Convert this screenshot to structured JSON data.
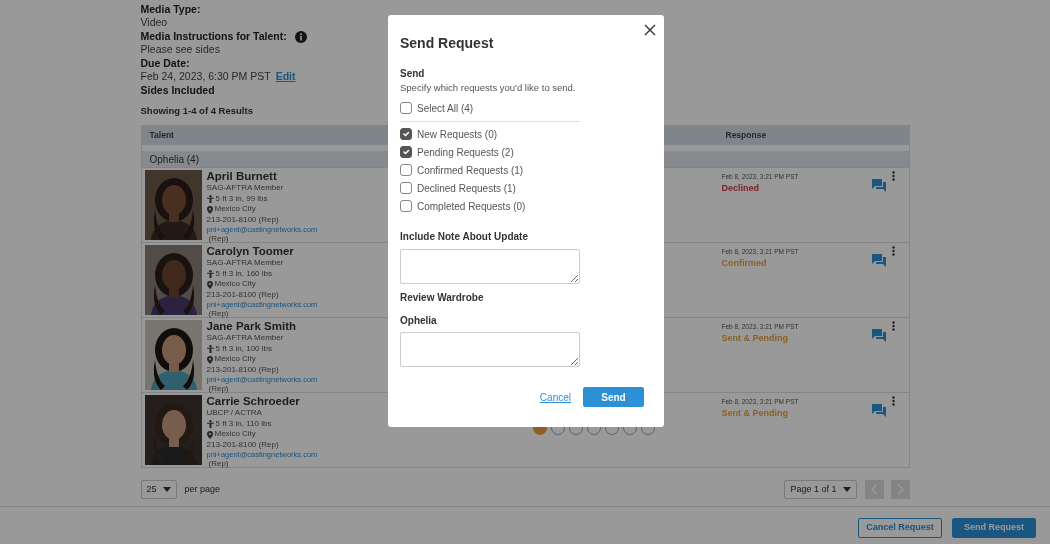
{
  "details": [
    {
      "label": "Media Type:",
      "value": "Video"
    },
    {
      "label": "Media Instructions for Talent:",
      "info": true,
      "value": "Please see sides"
    },
    {
      "label": "Due Date:",
      "value": "Feb 24, 2023, 6:30 PM PST",
      "link": "Edit"
    },
    {
      "label": "Sides Included"
    }
  ],
  "results_summary": "Showing 1-4 of 4 Results",
  "table": {
    "columns": [
      "Talent",
      "Response"
    ],
    "group": "Ophelia (4)",
    "rows": [
      {
        "name": "April Burnett",
        "union": "SAG-AFTRA Member",
        "size": "5 ft 3 in, 99 lbs",
        "location": "Mexico City",
        "phone": "213-201-8100 (Rep)",
        "email": "pni+agent@castingnetworks.com",
        "email_note": "(Rep)",
        "response_time": "Feb 8, 2023, 3:21 PM PST",
        "response": "Declined",
        "color": "#821f26"
      },
      {
        "name": "Carolyn Toomer",
        "union": "SAG-AFTRA Member",
        "size": "5 ft 3 in, 160 lbs",
        "location": "Mexico City",
        "phone": "213-201-8100 (Rep)",
        "email": "pni+agent@castingnetworks.com",
        "email_note": "(Rep)",
        "response_time": "Feb 8, 2023, 3:21 PM PST",
        "response": "Confirmed",
        "color": "#8b6123"
      },
      {
        "name": "Jane Park Smith",
        "union": "SAG-AFTRA Member",
        "size": "5 ft 3 in, 100 lbs",
        "location": "Mexico City",
        "phone": "213-201-8100 (Rep)",
        "email": "pni+agent@castingnetworks.com",
        "email_note": "(Rep)",
        "response_time": "Feb 8, 2023, 3:21 PM PST",
        "response": "Sent & Pending",
        "color": "#8b6123"
      },
      {
        "name": "Carrie Schroeder",
        "union": "UBCP / ACTRA",
        "size": "5 ft 3 in, 110 lbs",
        "location": "Mexico City",
        "phone": "213-201-8100 (Rep)",
        "email": "pni+agent@castingnetworks.com",
        "email_note": "(Rep)",
        "response_time": "Feb 8, 2023, 3:21 PM PST",
        "response": "Sent & Pending",
        "color": "#8b6123",
        "steps": [
          {
            "done": true
          },
          {
            "done": false
          },
          {
            "done": false
          },
          {
            "done": false
          },
          {
            "done": false
          },
          {
            "done": false
          },
          {
            "done": false
          }
        ]
      }
    ]
  },
  "pagination": {
    "per_page": "25",
    "per_page_label": "per page",
    "page": "Page 1 of 1"
  },
  "footer_buttons": [
    {
      "label": "Cancel Request",
      "kind": "outline"
    },
    {
      "label": "Send Request",
      "kind": "primary"
    }
  ],
  "modal": {
    "title": "Send Request",
    "section": "Send",
    "hint": "Specify which requests you'd like to send.",
    "select_all": {
      "label": "Select All (4)",
      "checked": false
    },
    "options": [
      {
        "label": "New Requests (0)",
        "checked": true
      },
      {
        "label": "Pending Requests (2)",
        "checked": true
      },
      {
        "label": "Confirmed Requests (1)",
        "checked": false
      },
      {
        "label": "Declined Requests (1)",
        "checked": false
      },
      {
        "label": "Completed Requests (0)",
        "checked": false
      }
    ],
    "note_label": "Include Note About Update",
    "wardrobe_label": "Review Wardrobe",
    "role_label": "Ophelia",
    "cancel": "Cancel",
    "send": "Send"
  }
}
